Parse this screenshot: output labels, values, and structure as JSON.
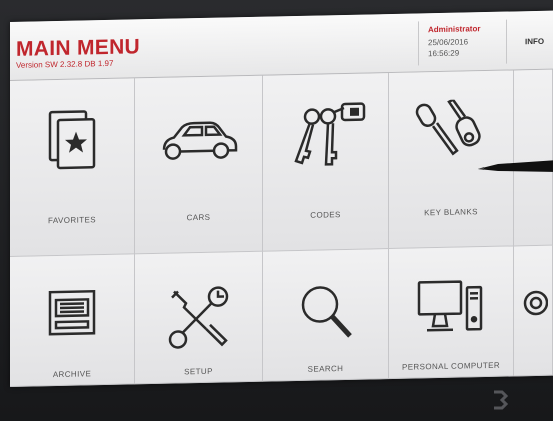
{
  "header": {
    "title": "MAIN MENU",
    "version": "Version SW 2.32.8 DB 1.97",
    "user": "Administrator",
    "date": "25/06/2016",
    "time": "16:56:29",
    "info_label": "INFO"
  },
  "menu": {
    "items": [
      {
        "label": "FAVORITES",
        "icon": "favorites-icon"
      },
      {
        "label": "CARS",
        "icon": "car-icon"
      },
      {
        "label": "CODES",
        "icon": "keys-tag-icon"
      },
      {
        "label": "KEY BLANKS",
        "icon": "key-blanks-icon"
      },
      {
        "label": "ARCHIVE",
        "icon": "archive-tray-icon"
      },
      {
        "label": "SETUP",
        "icon": "tools-icon"
      },
      {
        "label": "SEARCH",
        "icon": "magnifier-icon"
      },
      {
        "label": "PERSONAL COMPUTER",
        "icon": "computer-icon"
      },
      {
        "label": "",
        "icon": "power-icon"
      }
    ]
  },
  "colors": {
    "brand_red": "#c0262d",
    "tile_bg": "#eeeeef",
    "icon_stroke": "#2b2b2b"
  }
}
